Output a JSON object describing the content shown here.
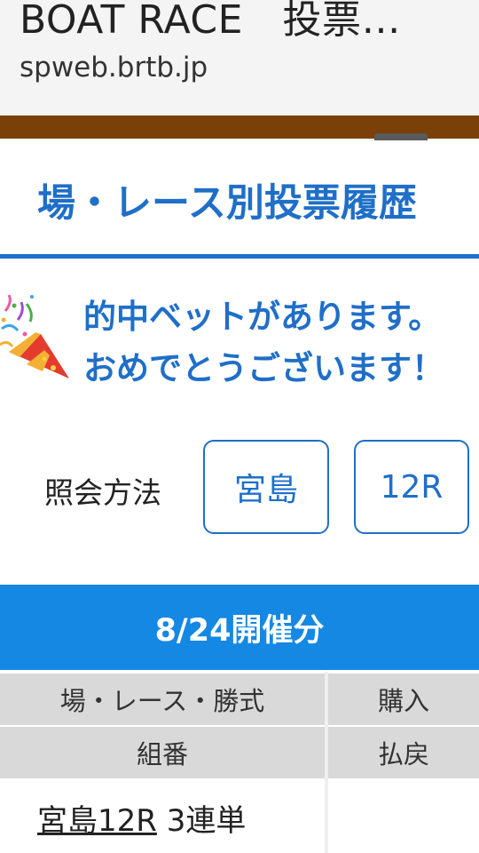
{
  "browser": {
    "title": "BOAT RACE　投票…",
    "domain": "spweb.brtb.jp"
  },
  "page": {
    "title": "場・レース別投票履歴",
    "message_line1": "的中ベットがあります。",
    "message_line2": "おめでとうございます！",
    "query_label": "照会方法",
    "venue_button": "宮島",
    "race_button": "12R",
    "date_header": "8/24開催分"
  },
  "table": {
    "header_row1": {
      "left": "場・レース・勝式",
      "right": "購入"
    },
    "header_row2": {
      "left": "組番",
      "right": "払戻"
    },
    "rows": [
      {
        "race_link": "宮島12R",
        "bet_type": "3連単"
      }
    ]
  },
  "icons": {
    "celebration": "party-popper-icon"
  },
  "colors": {
    "accent": "#1f6fc8",
    "date_bar": "#1588e4",
    "top_bar": "#7a4008"
  }
}
